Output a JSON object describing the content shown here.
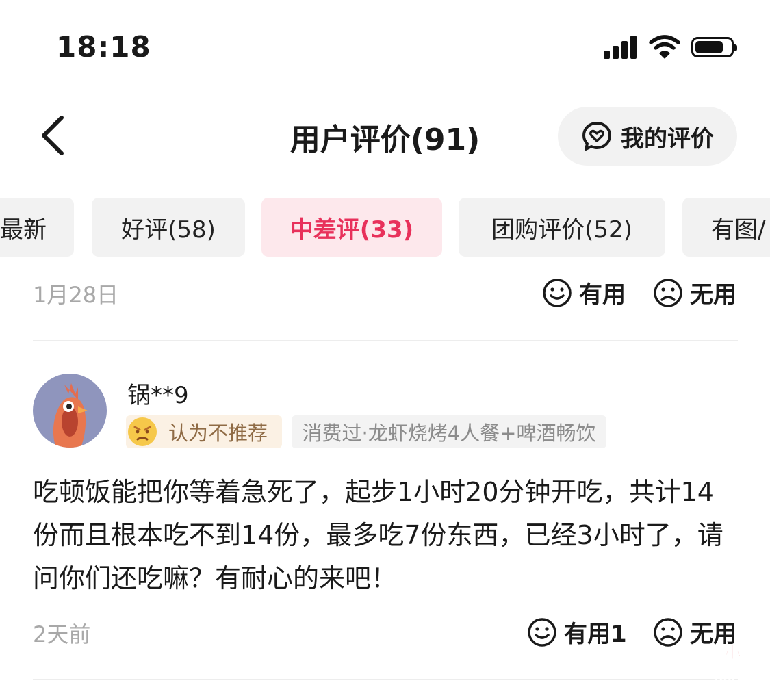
{
  "status_bar": {
    "time": "18:18"
  },
  "header": {
    "title": "用户评价(91)",
    "my_review_label": "我的评价"
  },
  "tabs": [
    {
      "label": "最新"
    },
    {
      "label": "好评(58)"
    },
    {
      "label": "中差评(33)"
    },
    {
      "label": "团购评价(52)"
    },
    {
      "label": "有图/"
    }
  ],
  "prev_review": {
    "date": "1月28日",
    "useful_label": "有用",
    "useless_label": "无用"
  },
  "review": {
    "username": "锅**9",
    "recommend_tag": "认为不推荐",
    "consume_tag": "消费过·龙虾烧烤4人餐+啤酒畅饮",
    "content": "吃顿饭能把你等着急死了，起步1小时20分钟开吃，共计14份而且根本吃不到14份，最多吃7份东西，已经3小时了，请问你们还吃嘛？有耐心的来吧！",
    "time": "2天前",
    "useful_label": "有用1",
    "useless_label": "无用"
  },
  "watermark": {
    "line1": "啊小",
    "line2": "热门"
  },
  "colors": {
    "accent": "#e8315b",
    "active_tab_bg": "#fde8ec"
  }
}
